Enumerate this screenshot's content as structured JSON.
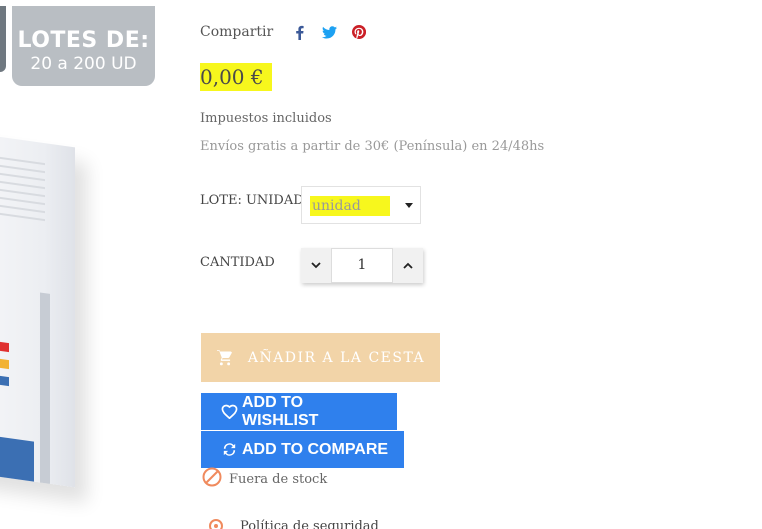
{
  "image_badge": {
    "line1": "LOTES DE:",
    "line2": "20 a 200 UD"
  },
  "share": {
    "label": "Compartir",
    "icons": [
      "facebook-icon",
      "twitter-icon",
      "pinterest-icon"
    ],
    "colors": {
      "facebook": "#3b5998",
      "twitter": "#1da1f2",
      "pinterest": "#cb2027"
    }
  },
  "price": "0,00 €",
  "taxes": "Impuestos incluidos",
  "shipping": "Envíos gratis a partir de 30€ (Península) en 24/48hs",
  "lote": {
    "label": "LOTE: UNIDAD",
    "selected": "unidad"
  },
  "quantity": {
    "label": "CANTIDAD",
    "value": "1"
  },
  "add_to_cart": {
    "label": "AÑADIR A LA CESTA",
    "color": "#f2d4a8"
  },
  "wishlist": {
    "label": "ADD TO WISHLIST",
    "color": "#2f80ed"
  },
  "compare": {
    "label": "ADD TO COMPARE",
    "color": "#2f80ed"
  },
  "stock": {
    "label": "Fuera de stock",
    "icon_color": "#f08a5d"
  },
  "policy": {
    "label": "Política de seguridad"
  },
  "highlight_color": "#f7f71d"
}
